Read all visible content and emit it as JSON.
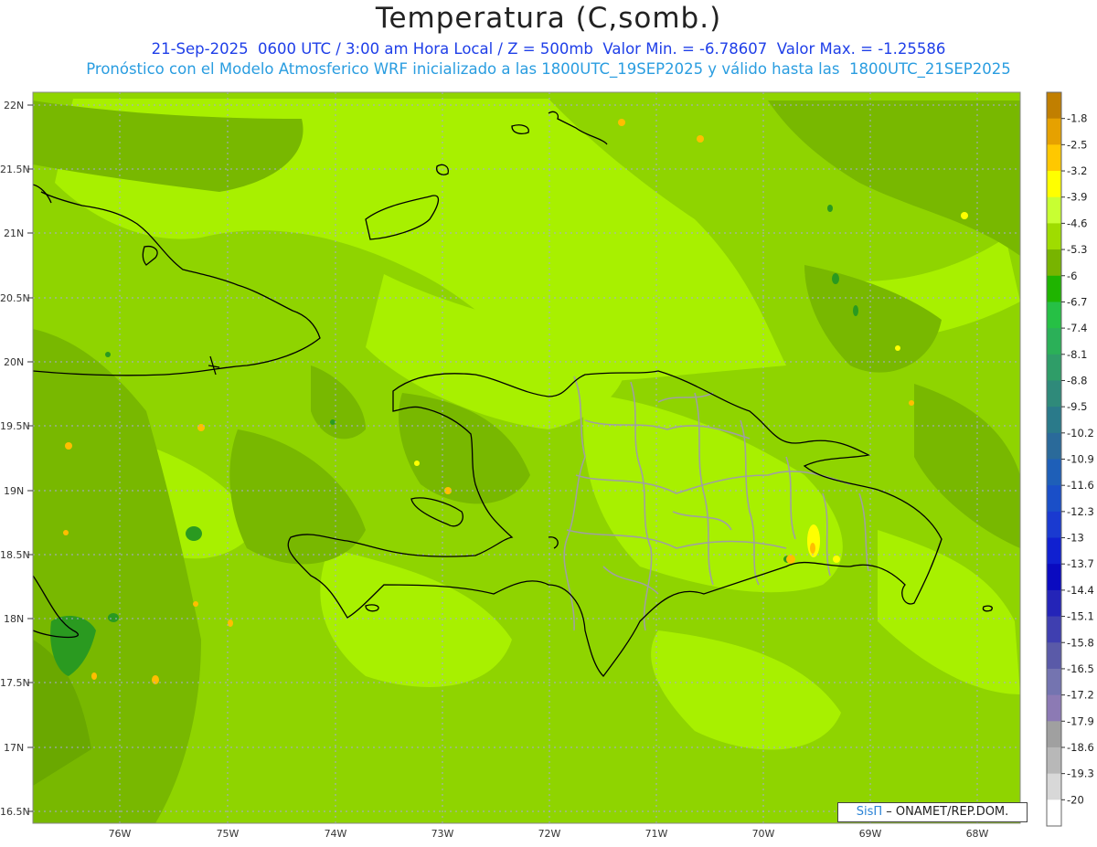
{
  "title": "Temperatura (C,somb.)",
  "subtitle_line1": "21-Sep-2025  0600 UTC / 3:00 am Hora Local / Z = 500mb  Valor Min. = -6.78607  Valor Max. = -1.25586",
  "subtitle_line2": "Pronóstico con el Modelo Atmosferico WRF inicializado a las 1800UTC_19SEP2025 y válido hasta las  1800UTC_21SEP2025",
  "lat_labels": [
    "22N",
    "21.5N",
    "21N",
    "20.5N",
    "20N",
    "19.5N",
    "19N",
    "18.5N",
    "18N",
    "17.5N",
    "17N",
    "16.5N"
  ],
  "lon_labels": [
    "76W",
    "75W",
    "74W",
    "73W",
    "72W",
    "71W",
    "70W",
    "69W",
    "68W"
  ],
  "legend": {
    "labels": [
      "-1.8",
      "-2.5",
      "-3.2",
      "-3.9",
      "-4.6",
      "-5.3",
      "-6",
      "-6.7",
      "-7.4",
      "-8.1",
      "-8.8",
      "-9.5",
      "-10.2",
      "-10.9",
      "-11.6",
      "-12.3",
      "-13",
      "-13.7",
      "-14.4",
      "-15.1",
      "-15.8",
      "-16.5",
      "-17.2",
      "-17.9",
      "-18.6",
      "-19.3",
      "-20"
    ],
    "colors": [
      "#c17f00",
      "#e6a100",
      "#ffc800",
      "#ffff00",
      "#c8ff32",
      "#9fdc00",
      "#78b400",
      "#1fb400",
      "#26c045",
      "#2bb058",
      "#2f9d68",
      "#2f8a7a",
      "#2a7a8a",
      "#2a6a9a",
      "#1e5fb8",
      "#1a4fc8",
      "#1a3ad0",
      "#1020d0",
      "#0a0ac0",
      "#2424b8",
      "#3f3fb0",
      "#5a5aa8",
      "#7474b0",
      "#8c7ab4",
      "#a0a0a0",
      "#b8b8b8",
      "#d8d8d8",
      "#ffffff"
    ]
  },
  "credit": {
    "brand": "SisΠ",
    "text": "– ONAMET/REP.DOM."
  },
  "field_colors": {
    "base": "#8fd400",
    "light": "#a8f000",
    "dark": "#78b800",
    "green": "#2a9a20",
    "yellow": "#ffff00",
    "orange": "#ffbe00"
  }
}
